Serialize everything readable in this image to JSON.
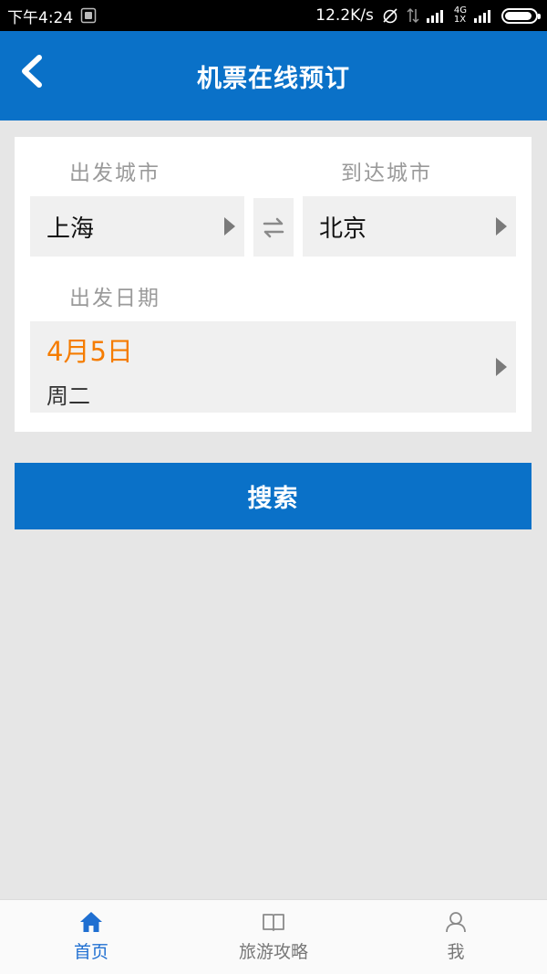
{
  "status_bar": {
    "time": "下午4:24",
    "speed": "12.2K/s",
    "network_top": "4G",
    "network_bottom": "1X",
    "battery_percent": 90
  },
  "header": {
    "title": "机票在线预订"
  },
  "form": {
    "departure_label": "出发城市",
    "arrival_label": "到达城市",
    "departure_city": "上海",
    "arrival_city": "北京",
    "date_label": "出发日期",
    "date": "4月5日",
    "weekday": "周二"
  },
  "search": {
    "label": "搜索"
  },
  "bottom_nav": {
    "items": [
      {
        "label": "首页",
        "icon": "home-icon"
      },
      {
        "label": "旅游攻略",
        "icon": "book-icon"
      },
      {
        "label": "我",
        "icon": "user-icon"
      }
    ]
  },
  "colors": {
    "primary": "#0a71c8",
    "accent": "#f57c00",
    "nav_active": "#1f6fd1"
  }
}
